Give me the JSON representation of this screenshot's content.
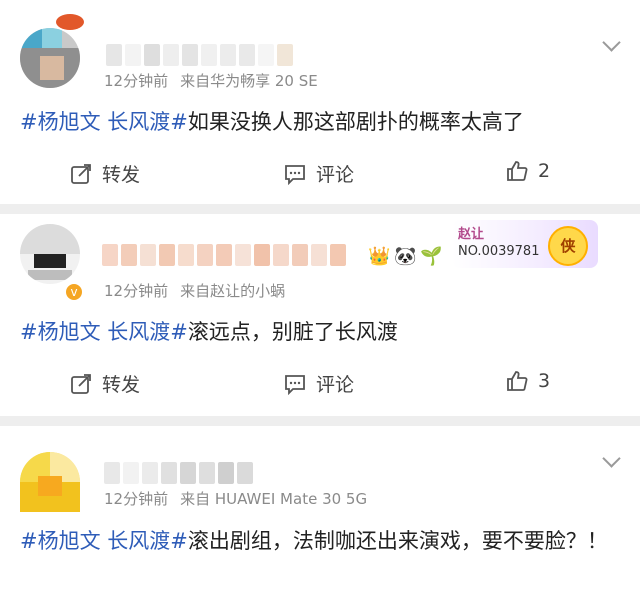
{
  "colors": {
    "accent": "#2e5cb8",
    "meta": "#8a8a8a",
    "vip": "#f5a623"
  },
  "comments": [
    {
      "time": "12分钟前",
      "source": "来自华为畅享 20 SE",
      "tag": "#杨旭文 长风渡#",
      "text": "如果没换人那这部剧扑的概率太高了",
      "repost_label": "转发",
      "comment_label": "评论",
      "like_count": "2"
    },
    {
      "time": "12分钟前",
      "source": "来自赵让的小蜗",
      "tag": "#杨旭文 长风渡#",
      "text": "滚远点，别脏了长风渡",
      "repost_label": "转发",
      "comment_label": "评论",
      "like_count": "3",
      "badge_name": "赵让",
      "badge_no": "NO.0039781",
      "badge_glyph": "侠"
    },
    {
      "time": "12分钟前",
      "source": "来自 HUAWEI Mate 30 5G",
      "tag": "#杨旭文 长风渡#",
      "text": "滚出剧组，法制咖还出来演戏，要不要脸？！"
    }
  ],
  "icons": [
    "chevron-down-icon",
    "repost-icon",
    "comment-icon",
    "like-icon",
    "crown-icon",
    "verified-icon"
  ]
}
